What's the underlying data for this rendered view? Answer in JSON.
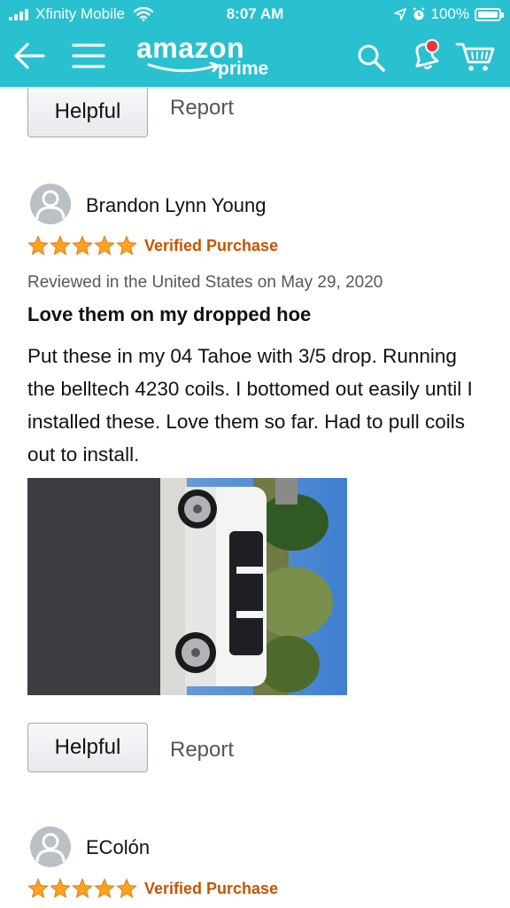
{
  "status_bar": {
    "carrier": "Xfinity Mobile",
    "time": "8:07 AM",
    "battery": "100%"
  },
  "header": {
    "logo_word": "amazon",
    "logo_sub": "prime",
    "accent_color": "#29c1cf",
    "icons": [
      "back-arrow-icon",
      "menu-icon",
      "search-icon",
      "bell-icon",
      "cart-icon"
    ]
  },
  "top_actions": {
    "helpful_label": "Helpful",
    "report_label": "Report"
  },
  "review1": {
    "reviewer": "Brandon Lynn Young",
    "rating": 5,
    "verified": "Verified Purchase",
    "meta": "Reviewed in the United States on May 29, 2020",
    "title": "Love them on my dropped hoe",
    "body": "Put these in my 04 Tahoe with 3/5 drop. Running the belltech 4230 coils. I bottomed out easily until I installed these. Love them so far. Had to pull coils out to install.",
    "helpful_label": "Helpful",
    "report_label": "Report"
  },
  "review2": {
    "reviewer": "EColón",
    "rating": 5,
    "verified": "Verified Purchase"
  }
}
